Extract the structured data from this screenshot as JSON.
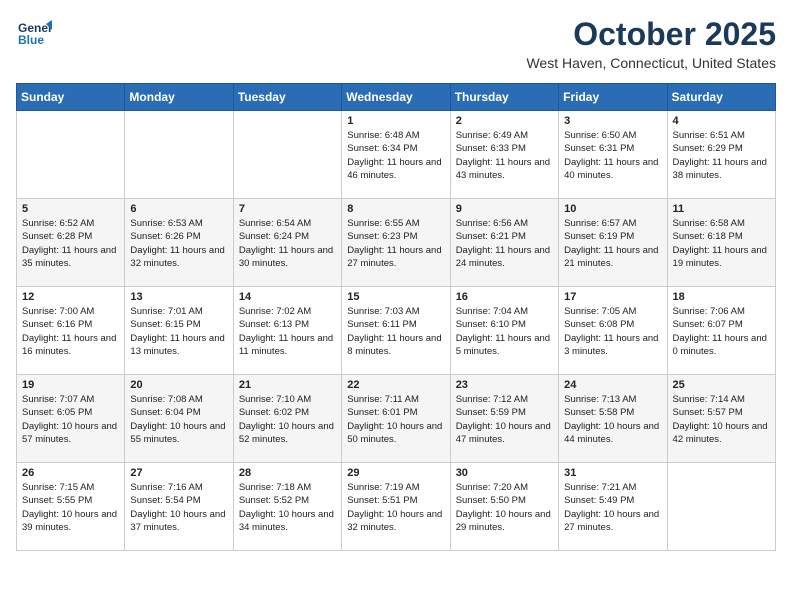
{
  "header": {
    "logo_line1": "General",
    "logo_line2": "Blue",
    "month": "October 2025",
    "location": "West Haven, Connecticut, United States"
  },
  "weekdays": [
    "Sunday",
    "Monday",
    "Tuesday",
    "Wednesday",
    "Thursday",
    "Friday",
    "Saturday"
  ],
  "weeks": [
    [
      {
        "day": "",
        "text": ""
      },
      {
        "day": "",
        "text": ""
      },
      {
        "day": "",
        "text": ""
      },
      {
        "day": "1",
        "text": "Sunrise: 6:48 AM\nSunset: 6:34 PM\nDaylight: 11 hours and 46 minutes."
      },
      {
        "day": "2",
        "text": "Sunrise: 6:49 AM\nSunset: 6:33 PM\nDaylight: 11 hours and 43 minutes."
      },
      {
        "day": "3",
        "text": "Sunrise: 6:50 AM\nSunset: 6:31 PM\nDaylight: 11 hours and 40 minutes."
      },
      {
        "day": "4",
        "text": "Sunrise: 6:51 AM\nSunset: 6:29 PM\nDaylight: 11 hours and 38 minutes."
      }
    ],
    [
      {
        "day": "5",
        "text": "Sunrise: 6:52 AM\nSunset: 6:28 PM\nDaylight: 11 hours and 35 minutes."
      },
      {
        "day": "6",
        "text": "Sunrise: 6:53 AM\nSunset: 6:26 PM\nDaylight: 11 hours and 32 minutes."
      },
      {
        "day": "7",
        "text": "Sunrise: 6:54 AM\nSunset: 6:24 PM\nDaylight: 11 hours and 30 minutes."
      },
      {
        "day": "8",
        "text": "Sunrise: 6:55 AM\nSunset: 6:23 PM\nDaylight: 11 hours and 27 minutes."
      },
      {
        "day": "9",
        "text": "Sunrise: 6:56 AM\nSunset: 6:21 PM\nDaylight: 11 hours and 24 minutes."
      },
      {
        "day": "10",
        "text": "Sunrise: 6:57 AM\nSunset: 6:19 PM\nDaylight: 11 hours and 21 minutes."
      },
      {
        "day": "11",
        "text": "Sunrise: 6:58 AM\nSunset: 6:18 PM\nDaylight: 11 hours and 19 minutes."
      }
    ],
    [
      {
        "day": "12",
        "text": "Sunrise: 7:00 AM\nSunset: 6:16 PM\nDaylight: 11 hours and 16 minutes."
      },
      {
        "day": "13",
        "text": "Sunrise: 7:01 AM\nSunset: 6:15 PM\nDaylight: 11 hours and 13 minutes."
      },
      {
        "day": "14",
        "text": "Sunrise: 7:02 AM\nSunset: 6:13 PM\nDaylight: 11 hours and 11 minutes."
      },
      {
        "day": "15",
        "text": "Sunrise: 7:03 AM\nSunset: 6:11 PM\nDaylight: 11 hours and 8 minutes."
      },
      {
        "day": "16",
        "text": "Sunrise: 7:04 AM\nSunset: 6:10 PM\nDaylight: 11 hours and 5 minutes."
      },
      {
        "day": "17",
        "text": "Sunrise: 7:05 AM\nSunset: 6:08 PM\nDaylight: 11 hours and 3 minutes."
      },
      {
        "day": "18",
        "text": "Sunrise: 7:06 AM\nSunset: 6:07 PM\nDaylight: 11 hours and 0 minutes."
      }
    ],
    [
      {
        "day": "19",
        "text": "Sunrise: 7:07 AM\nSunset: 6:05 PM\nDaylight: 10 hours and 57 minutes."
      },
      {
        "day": "20",
        "text": "Sunrise: 7:08 AM\nSunset: 6:04 PM\nDaylight: 10 hours and 55 minutes."
      },
      {
        "day": "21",
        "text": "Sunrise: 7:10 AM\nSunset: 6:02 PM\nDaylight: 10 hours and 52 minutes."
      },
      {
        "day": "22",
        "text": "Sunrise: 7:11 AM\nSunset: 6:01 PM\nDaylight: 10 hours and 50 minutes."
      },
      {
        "day": "23",
        "text": "Sunrise: 7:12 AM\nSunset: 5:59 PM\nDaylight: 10 hours and 47 minutes."
      },
      {
        "day": "24",
        "text": "Sunrise: 7:13 AM\nSunset: 5:58 PM\nDaylight: 10 hours and 44 minutes."
      },
      {
        "day": "25",
        "text": "Sunrise: 7:14 AM\nSunset: 5:57 PM\nDaylight: 10 hours and 42 minutes."
      }
    ],
    [
      {
        "day": "26",
        "text": "Sunrise: 7:15 AM\nSunset: 5:55 PM\nDaylight: 10 hours and 39 minutes."
      },
      {
        "day": "27",
        "text": "Sunrise: 7:16 AM\nSunset: 5:54 PM\nDaylight: 10 hours and 37 minutes."
      },
      {
        "day": "28",
        "text": "Sunrise: 7:18 AM\nSunset: 5:52 PM\nDaylight: 10 hours and 34 minutes."
      },
      {
        "day": "29",
        "text": "Sunrise: 7:19 AM\nSunset: 5:51 PM\nDaylight: 10 hours and 32 minutes."
      },
      {
        "day": "30",
        "text": "Sunrise: 7:20 AM\nSunset: 5:50 PM\nDaylight: 10 hours and 29 minutes."
      },
      {
        "day": "31",
        "text": "Sunrise: 7:21 AM\nSunset: 5:49 PM\nDaylight: 10 hours and 27 minutes."
      },
      {
        "day": "",
        "text": ""
      }
    ]
  ]
}
